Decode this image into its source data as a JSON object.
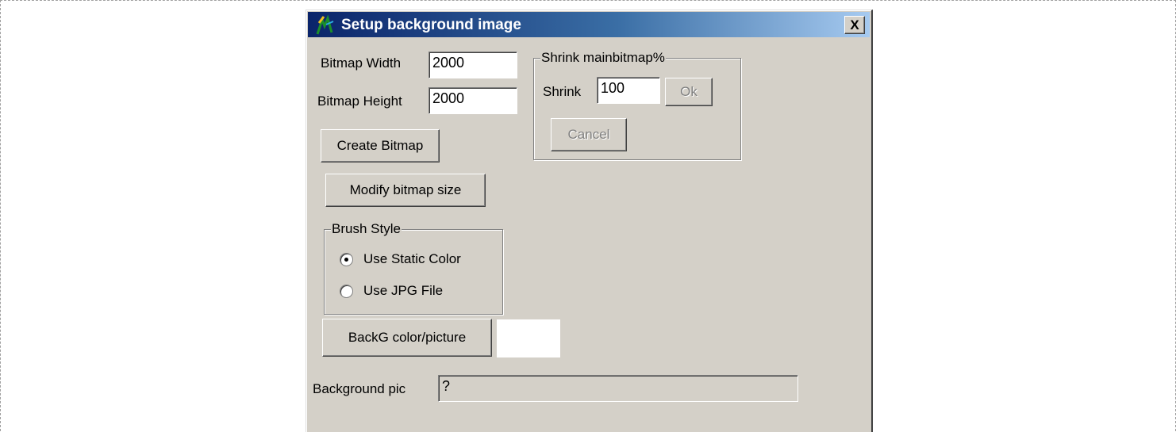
{
  "window": {
    "title": "Setup background image",
    "close_label": "X"
  },
  "bitmap": {
    "width_label": "Bitmap Width",
    "width_value": "2000",
    "height_label": "Bitmap Height",
    "height_value": "2000"
  },
  "buttons": {
    "create_bitmap": "Create Bitmap",
    "modify_size": "Modify bitmap size",
    "backg_color": "BackG color/picture"
  },
  "shrink": {
    "group_label": "Shrink mainbitmap%",
    "label": "Shrink",
    "value": "100",
    "ok_label": "Ok",
    "cancel_label": "Cancel"
  },
  "brush": {
    "group_label": "Brush Style",
    "option_static": "Use Static Color",
    "option_jpg": "Use JPG File",
    "selected": "Use Static Color"
  },
  "background_pic": {
    "label": "Background pic",
    "value": "?"
  },
  "colors": {
    "face": "#d4d0c8",
    "title_start": "#0a246a",
    "title_end": "#a6caf0",
    "swatch": "#ffffff"
  }
}
